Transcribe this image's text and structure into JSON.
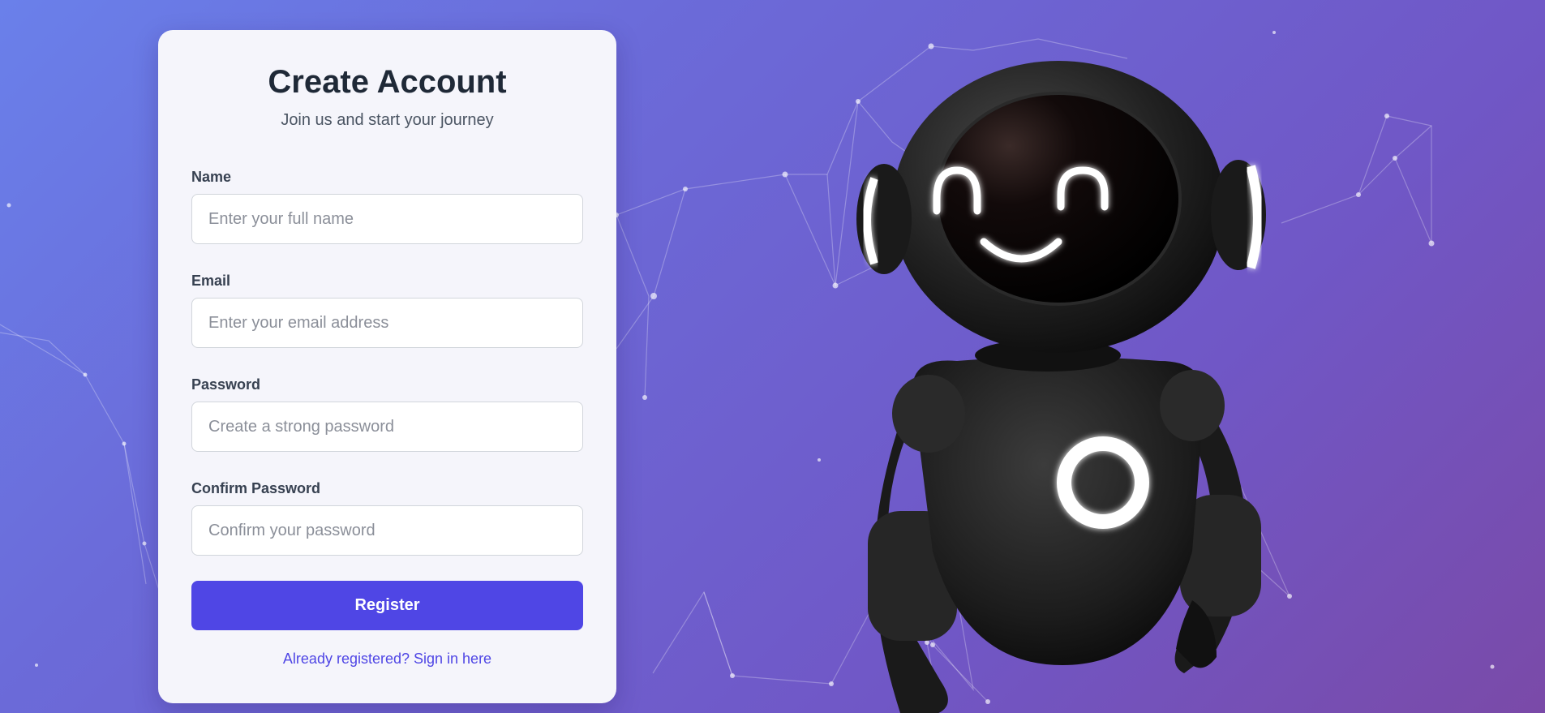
{
  "form": {
    "title": "Create Account",
    "subtitle": "Join us and start your journey",
    "fields": [
      {
        "label": "Name",
        "placeholder": "Enter your full name",
        "type": "text"
      },
      {
        "label": "Email",
        "placeholder": "Enter your email address",
        "type": "email"
      },
      {
        "label": "Password",
        "placeholder": "Create a strong password",
        "type": "password"
      },
      {
        "label": "Confirm Password",
        "placeholder": "Confirm your password",
        "type": "password"
      }
    ],
    "submit_label": "Register",
    "signin_link": "Already registered? Sign in here"
  },
  "illustration": {
    "icon": "robot-mascot-icon"
  },
  "colors": {
    "accent": "#4f46e5",
    "background_start": "#6a80ea",
    "background_end": "#7a4aa8",
    "card": "#f5f5fb"
  }
}
